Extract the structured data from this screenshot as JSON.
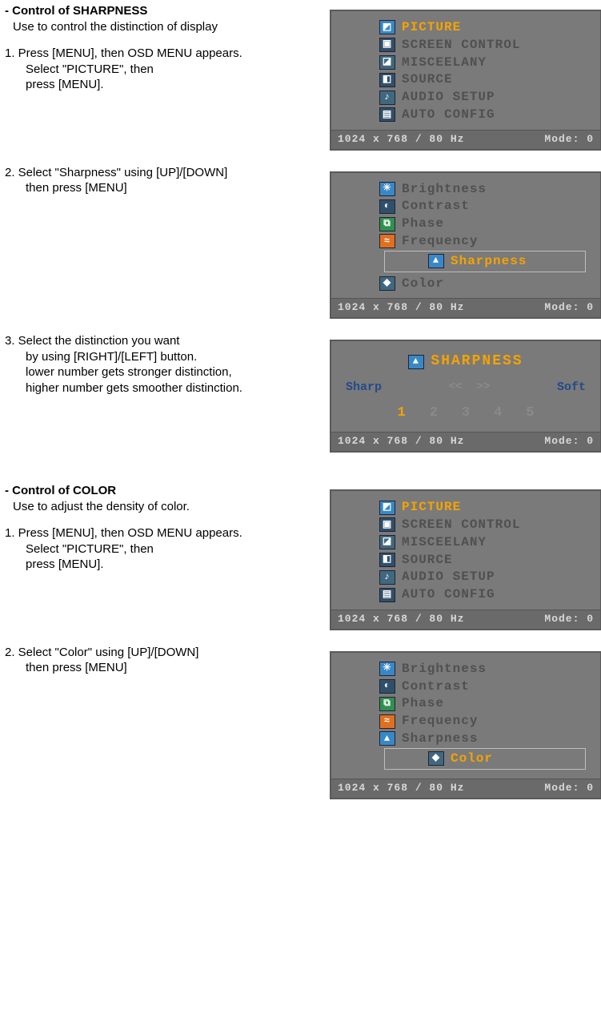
{
  "status": {
    "res": "1024  x   768  /   80  Hz",
    "mode": "Mode:   0"
  },
  "menu_main": [
    {
      "icon": "◩",
      "label": "PICTURE",
      "sel": true,
      "cls": ""
    },
    {
      "icon": "▣",
      "label": "SCREEN  CONTROL",
      "sel": false,
      "cls": "d"
    },
    {
      "icon": "◪",
      "label": "MISCEELANY",
      "sel": false,
      "cls": "c"
    },
    {
      "icon": "◧",
      "label": "SOURCE",
      "sel": false,
      "cls": "d"
    },
    {
      "icon": "♪",
      "label": "AUDIO  SETUP",
      "sel": false,
      "cls": "c"
    },
    {
      "icon": "▤",
      "label": "AUTO  CONFIG",
      "sel": false,
      "cls": "d"
    }
  ],
  "menu_picture_sharp": [
    {
      "icon": "☀",
      "label": "Brightness",
      "sel": false,
      "cls": ""
    },
    {
      "icon": "◐",
      "label": "Contrast",
      "sel": false,
      "cls": "d"
    },
    {
      "icon": "⧉",
      "label": "Phase",
      "sel": false,
      "cls": "g"
    },
    {
      "icon": "≈",
      "label": "Frequency",
      "sel": false,
      "cls": "o"
    },
    {
      "icon": "▲",
      "label": "Sharpness",
      "sel": true,
      "cls": "",
      "boxed": true
    },
    {
      "icon": "◆",
      "label": "Color",
      "sel": false,
      "cls": "c"
    }
  ],
  "menu_picture_color": [
    {
      "icon": "☀",
      "label": "Brightness",
      "sel": false,
      "cls": ""
    },
    {
      "icon": "◐",
      "label": "Contrast",
      "sel": false,
      "cls": "d"
    },
    {
      "icon": "⧉",
      "label": "Phase",
      "sel": false,
      "cls": "g"
    },
    {
      "icon": "≈",
      "label": "Frequency",
      "sel": false,
      "cls": "o"
    },
    {
      "icon": "▲",
      "label": "Sharpness",
      "sel": false,
      "cls": ""
    },
    {
      "icon": "◆",
      "label": "Color",
      "sel": true,
      "cls": "c",
      "boxed": true
    }
  ],
  "sharpness_panel": {
    "title": "SHARPNESS",
    "icon": "▲",
    "left": "Sharp",
    "right": "Soft",
    "arrow_l": "<<",
    "arrow_r": ">>",
    "nums": [
      "1",
      "2",
      "3",
      "4",
      "5"
    ],
    "selected": 0
  },
  "sections": {
    "s1": {
      "head": "- Control of SHARPNESS",
      "sub": "Use to control the distinction of display",
      "step1a": "1. Press [MENU], then OSD MENU appears.",
      "step1b": "Select \"PICTURE\", then",
      "step1c": "press [MENU].",
      "step2a": "2. Select \"Sharpness\" using [UP]/[DOWN]",
      "step2b": "then press [MENU]",
      "step3a": "3. Select the distinction you want",
      "step3b": "by using [RIGHT]/[LEFT] button.",
      "step3c": "lower number gets stronger distinction,",
      "step3d": "higher number gets smoother distinction."
    },
    "s2": {
      "head": "- Control of COLOR",
      "sub": "Use to adjust the density of color.",
      "step1a": "1. Press [MENU], then OSD MENU appears.",
      "step1b": "Select \"PICTURE\", then",
      "step1c": "press [MENU].",
      "step2a": "2. Select \"Color\" using [UP]/[DOWN]",
      "step2b": "then press [MENU]"
    }
  }
}
